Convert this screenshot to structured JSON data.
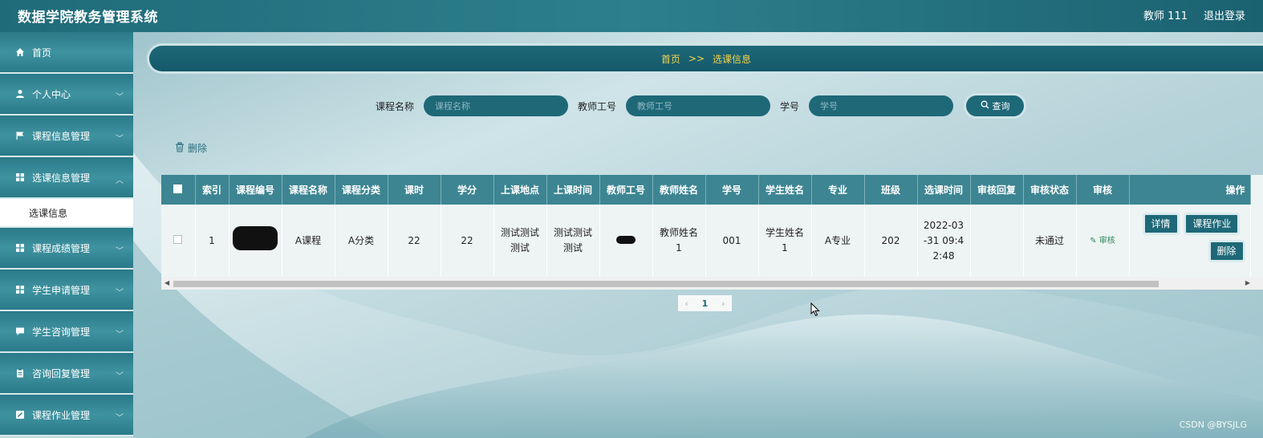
{
  "header": {
    "title": "数据学院教务管理系统",
    "user": "教师 111",
    "logout": "退出登录"
  },
  "sidebar": {
    "items": [
      {
        "label": "首页",
        "icon": "home-icon",
        "has_chevron": false
      },
      {
        "label": "个人中心",
        "icon": "user-icon",
        "has_chevron": true
      },
      {
        "label": "课程信息管理",
        "icon": "flag-icon",
        "has_chevron": true
      },
      {
        "label": "选课信息管理",
        "icon": "grid-icon",
        "has_chevron": true
      },
      {
        "label": "课程成绩管理",
        "icon": "grid-icon",
        "has_chevron": true
      },
      {
        "label": "学生申请管理",
        "icon": "grid-icon",
        "has_chevron": true
      },
      {
        "label": "学生咨询管理",
        "icon": "chat-icon",
        "has_chevron": true
      },
      {
        "label": "咨询回复管理",
        "icon": "clipboard-icon",
        "has_chevron": true
      },
      {
        "label": "课程作业管理",
        "icon": "edit-square-icon",
        "has_chevron": true
      }
    ],
    "active_submenu": "选课信息"
  },
  "breadcrumb": {
    "home": "首页",
    "separator": ">>",
    "current": "选课信息"
  },
  "search": {
    "course_name_label": "课程名称",
    "course_name_placeholder": "课程名称",
    "teacher_id_label": "教师工号",
    "teacher_id_placeholder": "教师工号",
    "student_id_label": "学号",
    "student_id_placeholder": "学号",
    "query_label": "查询"
  },
  "toolbar": {
    "delete_label": "删除"
  },
  "table": {
    "columns": [
      "索引",
      "课程编号",
      "课程名称",
      "课程分类",
      "课时",
      "学分",
      "上课地点",
      "上课时间",
      "教师工号",
      "教师姓名",
      "学号",
      "学生姓名",
      "专业",
      "班级",
      "选课时间",
      "审核回复",
      "审核状态",
      "审核",
      "操作"
    ],
    "rows": [
      {
        "index": "1",
        "course_no": "",
        "course_name": "A课程",
        "category": "A分类",
        "hours": "22",
        "credit": "22",
        "location": "测试测试测试",
        "time": "测试测试测试",
        "teacher_id": "",
        "teacher_name": "教师姓名1",
        "student_id": "001",
        "student_name": "学生姓名1",
        "major": "A专业",
        "class": "202",
        "select_time": "2022-03-31 09:42:48",
        "audit_reply": "",
        "audit_status": "未通过",
        "audit_action": "审核",
        "actions": {
          "detail": "详情",
          "homework": "课程作业",
          "delete": "删除"
        }
      }
    ]
  },
  "pagination": {
    "current_page": "1",
    "prev": "‹",
    "next": "›"
  },
  "watermark": "CSDN @BYSJLG",
  "colors": {
    "primary": "#1e6878",
    "header_bg": "#2d7f8d",
    "table_header": "#3d8592",
    "breadcrumb_text": "#f4d34a"
  }
}
